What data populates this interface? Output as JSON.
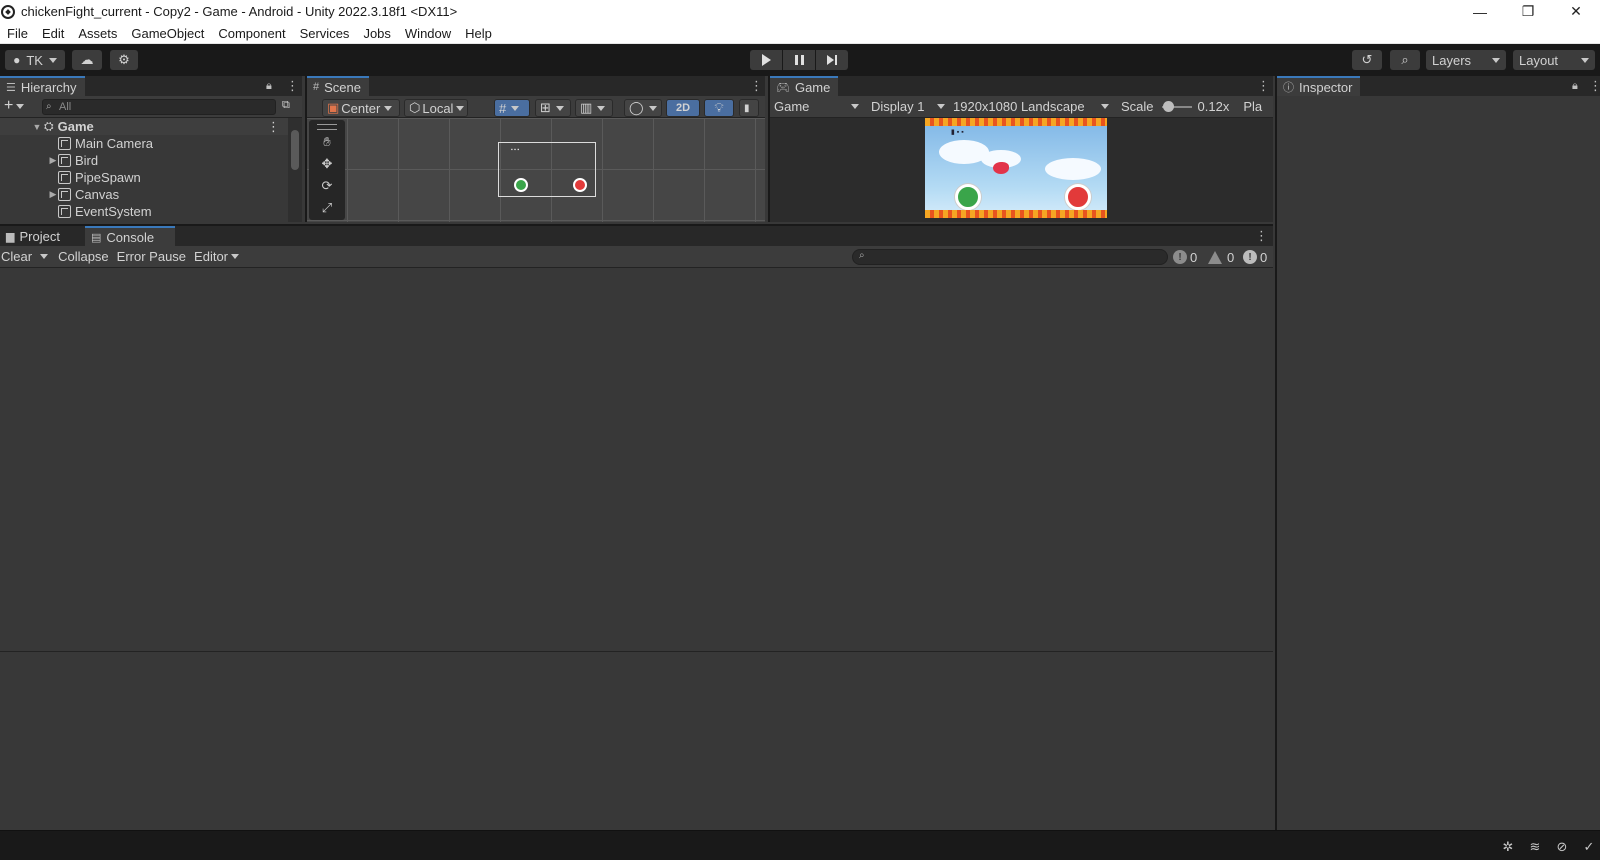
{
  "window": {
    "title": "chickenFight_current - Copy2 - Game - Android - Unity 2022.3.18f1 <DX11>",
    "controls": {
      "minimize": "—",
      "restore": "❐",
      "close": "✕"
    }
  },
  "menu": [
    "File",
    "Edit",
    "Assets",
    "GameObject",
    "Component",
    "Services",
    "Jobs",
    "Window",
    "Help"
  ],
  "toolbar": {
    "account_label": "TK",
    "layers_label": "Layers",
    "layout_label": "Layout"
  },
  "hierarchy": {
    "tab_label": "Hierarchy",
    "search_placeholder": "All",
    "scene_name": "Game",
    "items": [
      {
        "label": "Main Camera",
        "expandable": false
      },
      {
        "label": "Bird",
        "expandable": true
      },
      {
        "label": "PipeSpawn",
        "expandable": false
      },
      {
        "label": "Canvas",
        "expandable": true
      },
      {
        "label": "EventSystem",
        "expandable": false
      }
    ]
  },
  "scene": {
    "tab_label": "Scene",
    "pivot_label": "Center",
    "space_label": "Local",
    "mode_2d_label": "2D"
  },
  "game": {
    "tab_label": "Game",
    "view_mode": "Game",
    "display": "Display 1",
    "resolution": "1920x1080 Landscape",
    "scale_label": "Scale",
    "scale_value": "0.12x",
    "play_label": "Pla",
    "scale_fraction": 0.05
  },
  "inspector": {
    "tab_label": "Inspector"
  },
  "bottom_tabs": {
    "project_label": "Project",
    "console_label": "Console"
  },
  "console": {
    "clear_label": "Clear",
    "collapse_label": "Collapse",
    "error_pause_label": "Error Pause",
    "editor_label": "Editor",
    "info_count": "0",
    "warning_count": "0",
    "error_count": "0"
  },
  "colors": {
    "background": "#383838",
    "toolbar": "#191919",
    "tab_active_accent": "#3a79bb",
    "game_green_button": "#3aa54a",
    "game_red_button": "#e23a3a"
  }
}
